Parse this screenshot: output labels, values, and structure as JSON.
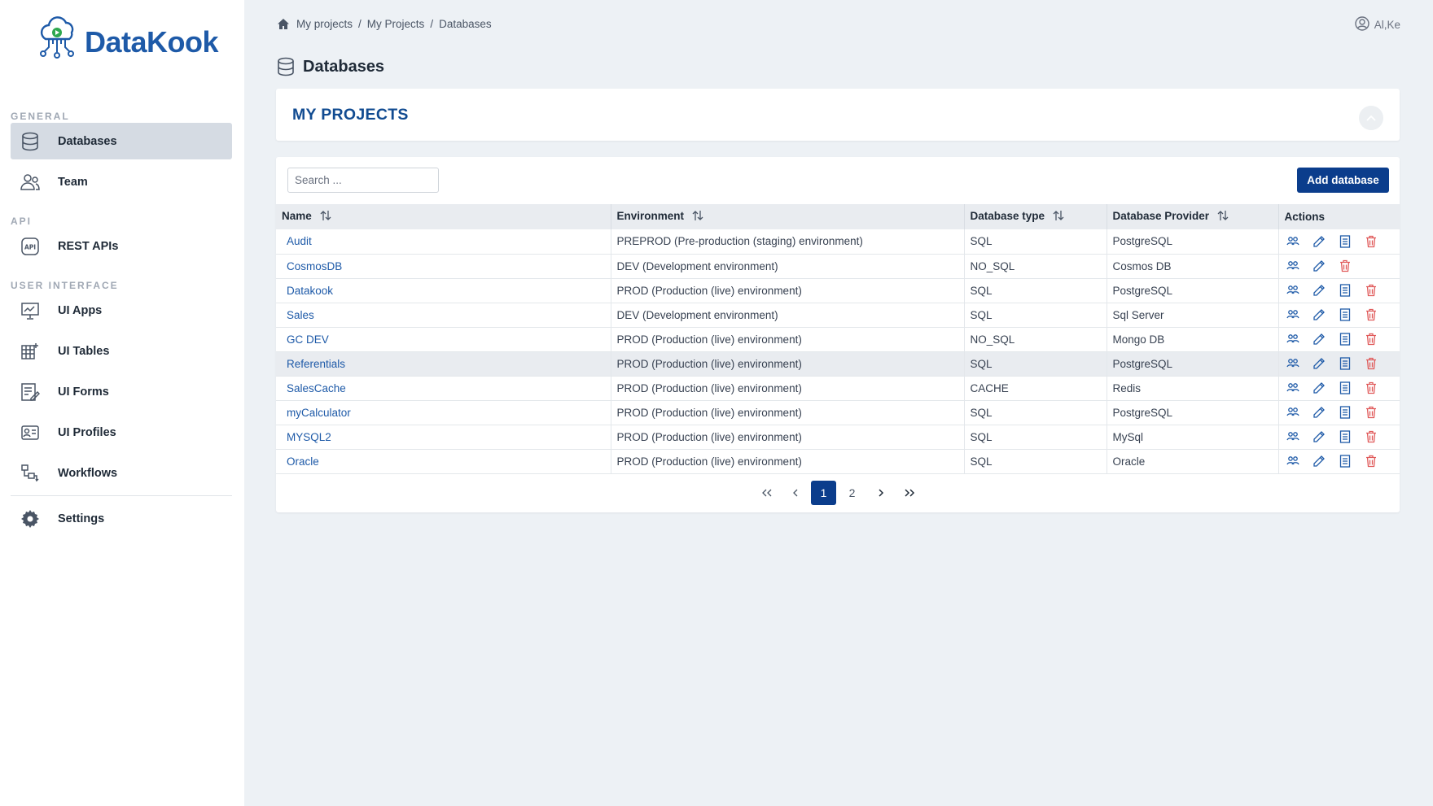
{
  "app": {
    "name": "DataKook"
  },
  "sidebar": {
    "sections": [
      "GENERAL",
      "API",
      "USER INTERFACE"
    ],
    "items": [
      {
        "label": "Databases",
        "icon": "database-icon",
        "active": true
      },
      {
        "label": "Team",
        "icon": "team-icon"
      },
      {
        "label": "REST APIs",
        "icon": "api-icon"
      },
      {
        "label": "UI Apps",
        "icon": "chart-board-icon"
      },
      {
        "label": "UI Tables",
        "icon": "table-grid-icon"
      },
      {
        "label": "UI Forms",
        "icon": "form-icon"
      },
      {
        "label": "UI Profiles",
        "icon": "profile-card-icon"
      },
      {
        "label": "Workflows",
        "icon": "workflow-icon"
      },
      {
        "label": "Settings",
        "icon": "gear-icon"
      }
    ]
  },
  "breadcrumb": [
    "My projects",
    "My Projects",
    "Databases"
  ],
  "user": {
    "name": "Al,Ke"
  },
  "page": {
    "title": "Databases"
  },
  "projects": {
    "title": "MY PROJECTS"
  },
  "search": {
    "placeholder": "Search ..."
  },
  "toolbar": {
    "add_label": "Add database"
  },
  "table": {
    "columns": [
      "Name",
      "Environment",
      "Database type",
      "Database Provider",
      "Actions"
    ],
    "rows": [
      {
        "name": "Audit",
        "env": "PREPROD (Pre-production (staging) environment)",
        "type": "SQL",
        "provider": "PostgreSQL",
        "actions": [
          "people",
          "edit",
          "doc",
          "delete"
        ]
      },
      {
        "name": "CosmosDB",
        "env": "DEV (Development environment)",
        "type": "NO_SQL",
        "provider": "Cosmos DB",
        "actions": [
          "people",
          "edit",
          "delete"
        ]
      },
      {
        "name": "Datakook",
        "env": "PROD (Production (live) environment)",
        "type": "SQL",
        "provider": "PostgreSQL",
        "actions": [
          "people",
          "edit",
          "doc",
          "delete"
        ]
      },
      {
        "name": "Sales",
        "env": "DEV (Development environment)",
        "type": "SQL",
        "provider": "Sql Server",
        "actions": [
          "people",
          "edit",
          "doc",
          "delete"
        ]
      },
      {
        "name": "GC DEV",
        "env": "PROD (Production (live) environment)",
        "type": "NO_SQL",
        "provider": "Mongo DB",
        "actions": [
          "people",
          "edit",
          "doc",
          "delete"
        ]
      },
      {
        "name": "Referentials",
        "env": "PROD (Production (live) environment)",
        "type": "SQL",
        "provider": "PostgreSQL",
        "actions": [
          "people",
          "edit",
          "doc",
          "delete"
        ],
        "highlighted": true
      },
      {
        "name": "SalesCache",
        "env": "PROD (Production (live) environment)",
        "type": "CACHE",
        "provider": "Redis",
        "actions": [
          "people",
          "edit",
          "doc",
          "delete"
        ]
      },
      {
        "name": "myCalculator",
        "env": "PROD (Production (live) environment)",
        "type": "SQL",
        "provider": "PostgreSQL",
        "actions": [
          "people",
          "edit",
          "doc",
          "delete"
        ]
      },
      {
        "name": "MYSQL2",
        "env": "PROD (Production (live) environment)",
        "type": "SQL",
        "provider": "MySql",
        "actions": [
          "people",
          "edit",
          "doc",
          "delete"
        ]
      },
      {
        "name": "Oracle",
        "env": "PROD (Production (live) environment)",
        "type": "SQL",
        "provider": "Oracle",
        "actions": [
          "people",
          "edit",
          "doc",
          "delete"
        ]
      }
    ]
  },
  "pagination": {
    "pages": [
      "1",
      "2"
    ],
    "current": "1"
  },
  "colors": {
    "primary": "#0b3d8c",
    "link": "#1e5aa8",
    "delete": "#e05a5a",
    "title": "#114b91"
  }
}
